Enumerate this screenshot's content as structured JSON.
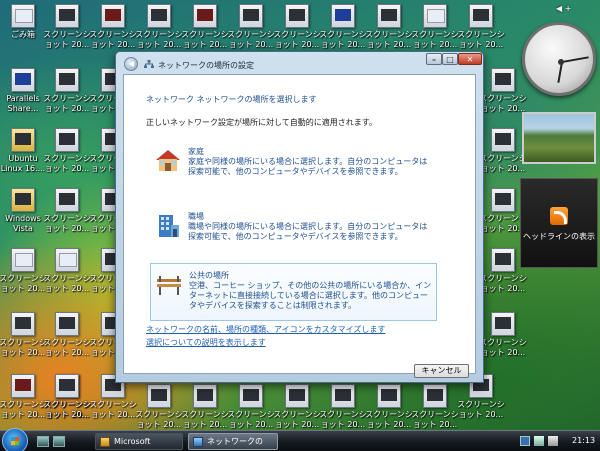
{
  "desktop": {
    "recycle_bin": "ごみ箱",
    "parallels_label": "Parallels Share...",
    "ubuntu_label": "Ubuntu Linux 16....",
    "vista_label": "Windows Vista",
    "screenshot_label": "スクリーンシ ョット 20..."
  },
  "sidebar": {
    "nav": "◀ +",
    "feed_label": "ヘッドラインの表示"
  },
  "dialog": {
    "title": "ネットワークの場所の設定",
    "heading": "ネットワーク ネットワークの場所を選択します",
    "subtext": "正しいネットワーク設定が場所に対して自動的に適用されます。",
    "options": [
      {
        "title": "家庭",
        "desc": "家庭や同様の場所にいる場合に選択します。自分のコンピュータは探索可能で、他のコンピュータやデバイスを参照できます。"
      },
      {
        "title": "職場",
        "desc": "職場や同様の場所にいる場合に選択します。自分のコンピュータは探索可能で、他のコンピュータやデバイスを参照できます。"
      },
      {
        "title": "公共の場所",
        "desc": "空港、コーヒー ショップ、その他の公共の場所にいる場合か、インターネットに直接接続している場合に選択します。他のコンピュータやデバイスを探索することは制限されます。"
      }
    ],
    "link_customize": "ネットワークの名前、場所の種類、アイコンをカスタマイズします",
    "link_explain": "選択についての説明を表示します",
    "cancel": "キャンセル"
  },
  "taskbar": {
    "buttons": [
      "Microsoft Windows",
      "ネットワークの場..."
    ],
    "clock": "21:13"
  }
}
